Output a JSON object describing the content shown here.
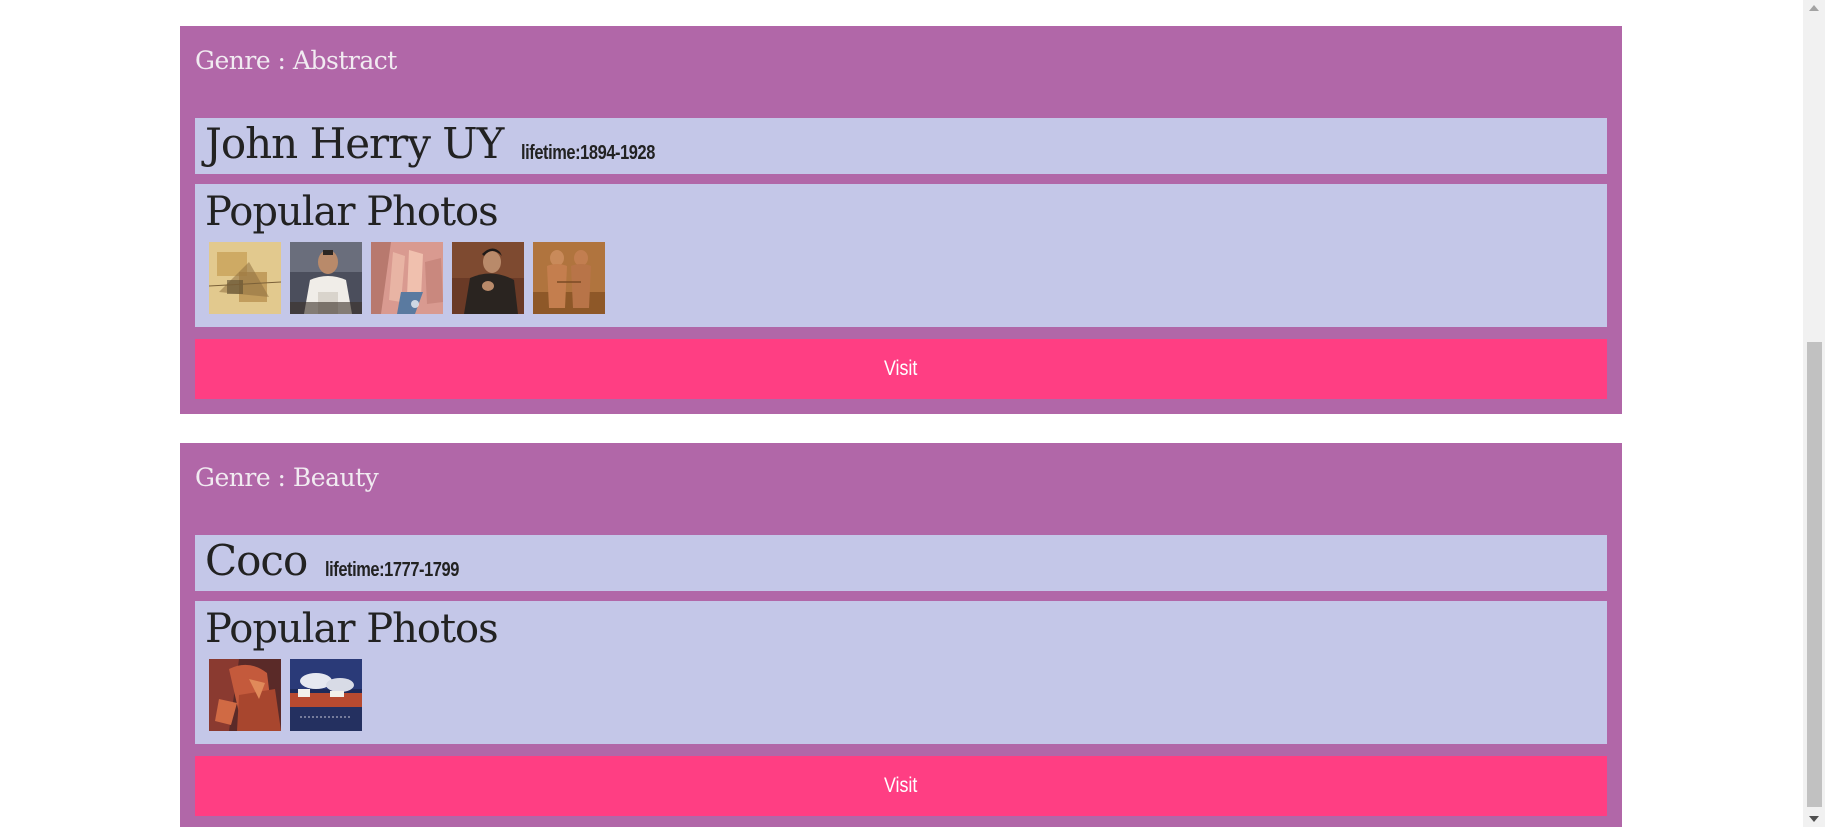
{
  "cards": [
    {
      "genre_label": "Genre : Abstract",
      "artist_name": "John Herry UY",
      "lifetime": "lifetime:1894-1928",
      "photos_title": "Popular Photos",
      "visit_label": "Visit",
      "photos": [
        "painting-1",
        "painting-2",
        "painting-3",
        "painting-4",
        "painting-5"
      ]
    },
    {
      "genre_label": "Genre : Beauty",
      "artist_name": "Coco",
      "lifetime": "lifetime:1777-1799",
      "photos_title": "Popular Photos",
      "visit_label": "Visit",
      "photos": [
        "painting-1",
        "painting-2"
      ]
    }
  ],
  "colors": {
    "card_bg": "#b167a8",
    "panel_bg": "#c4c7e8",
    "button_bg": "#ff3e83",
    "genre_text": "#f1ebf1"
  }
}
